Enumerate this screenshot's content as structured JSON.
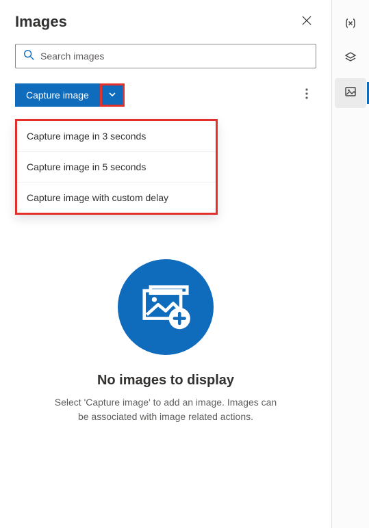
{
  "header": {
    "title": "Images"
  },
  "search": {
    "placeholder": "Search images"
  },
  "toolbar": {
    "capture_label": "Capture image"
  },
  "dropdown": {
    "items": [
      {
        "label": "Capture image in 3 seconds"
      },
      {
        "label": "Capture image in 5 seconds"
      },
      {
        "label": "Capture image with custom delay"
      }
    ]
  },
  "empty": {
    "title": "No images to display",
    "description": "Select 'Capture image' to add an image. Images can be associated with image related actions."
  }
}
